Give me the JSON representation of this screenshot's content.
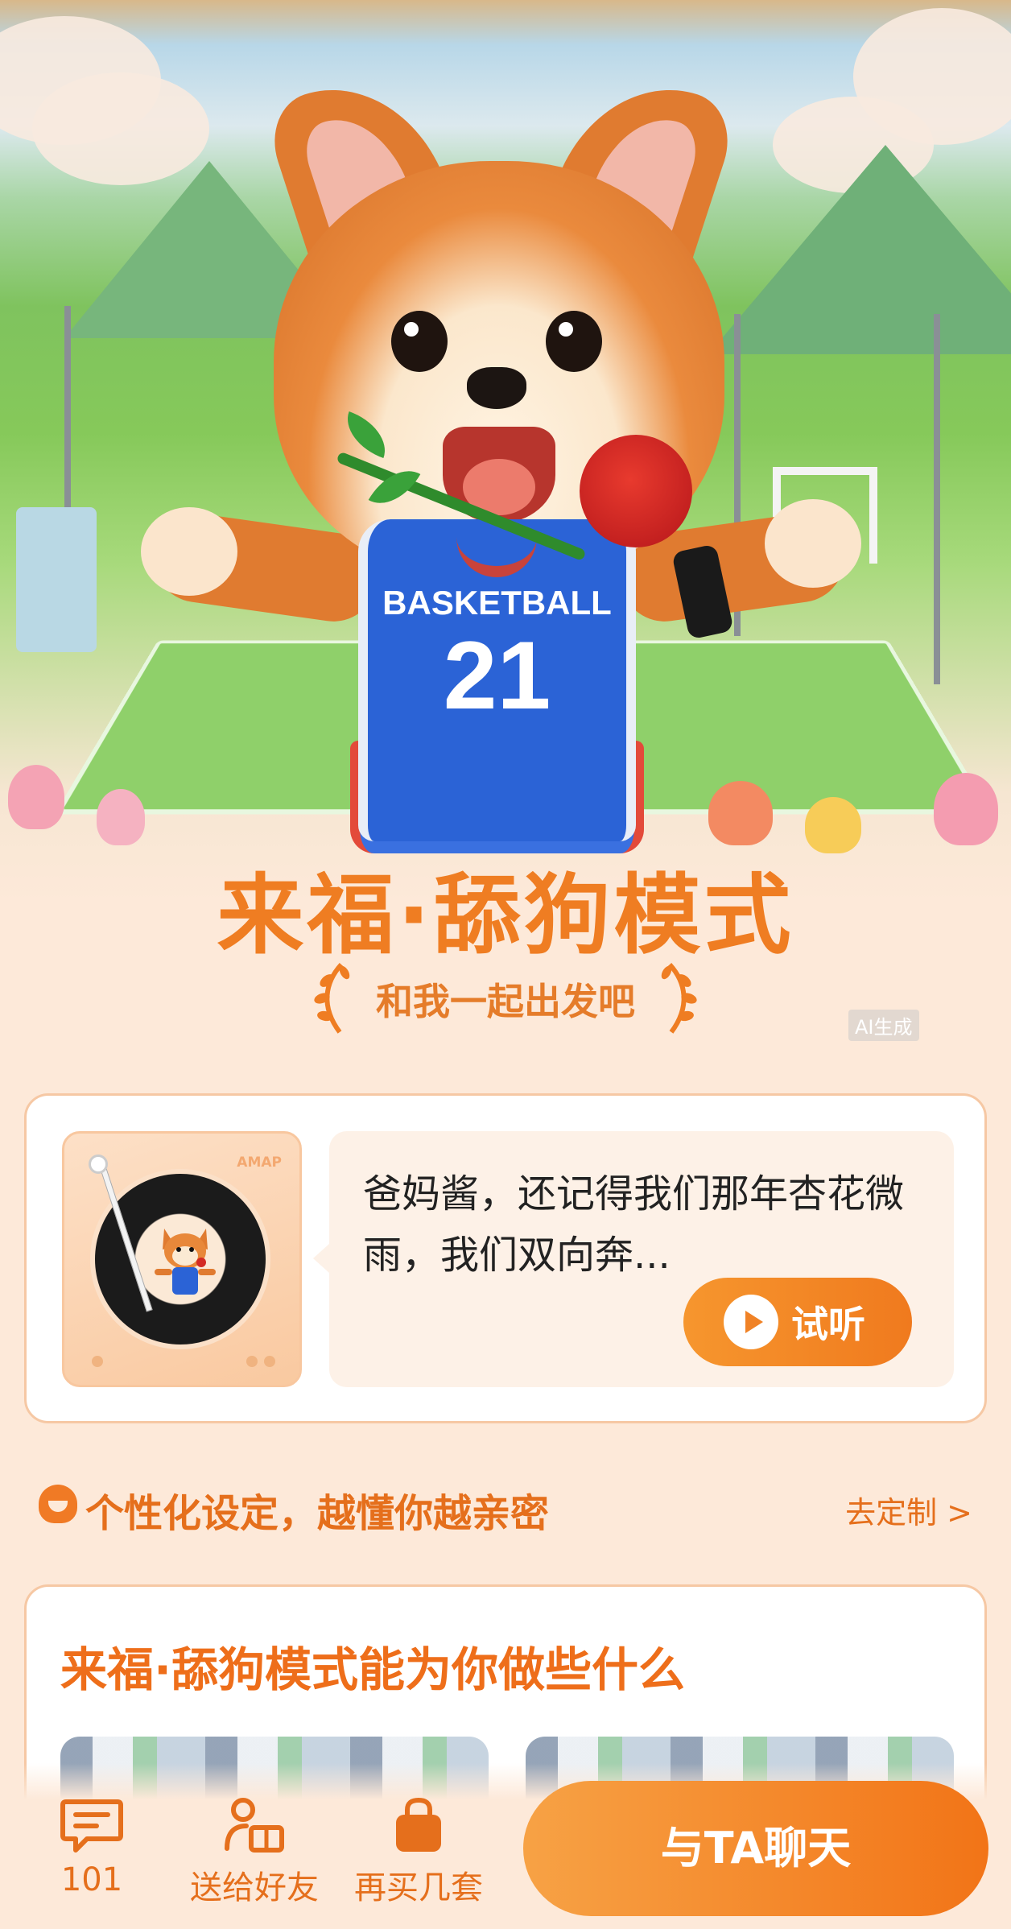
{
  "hero": {
    "jersey_word": "BASKETBALL",
    "jersey_number": "21"
  },
  "title": "来福·舔狗模式",
  "subtitle": "和我一起出发吧",
  "ai_badge": "AI生成",
  "audio_card": {
    "player_label": "AMAP",
    "message": "爸妈酱，还记得我们那年杏花微雨，我们双向奔...",
    "listen_label": "试听"
  },
  "personalize": {
    "text": "个性化设定，越懂你越亲密",
    "link": "去定制 >"
  },
  "feature": {
    "title": "来福·舔狗模式能为你做些什么"
  },
  "bottom_bar": {
    "messages_count": "101",
    "gift_label": "送给好友",
    "buy_label": "再买几套",
    "chat_label": "与TA聊天"
  },
  "colors": {
    "accent": "#ef7d22",
    "background": "#fde9d9",
    "card_border": "#f6c8a4"
  }
}
